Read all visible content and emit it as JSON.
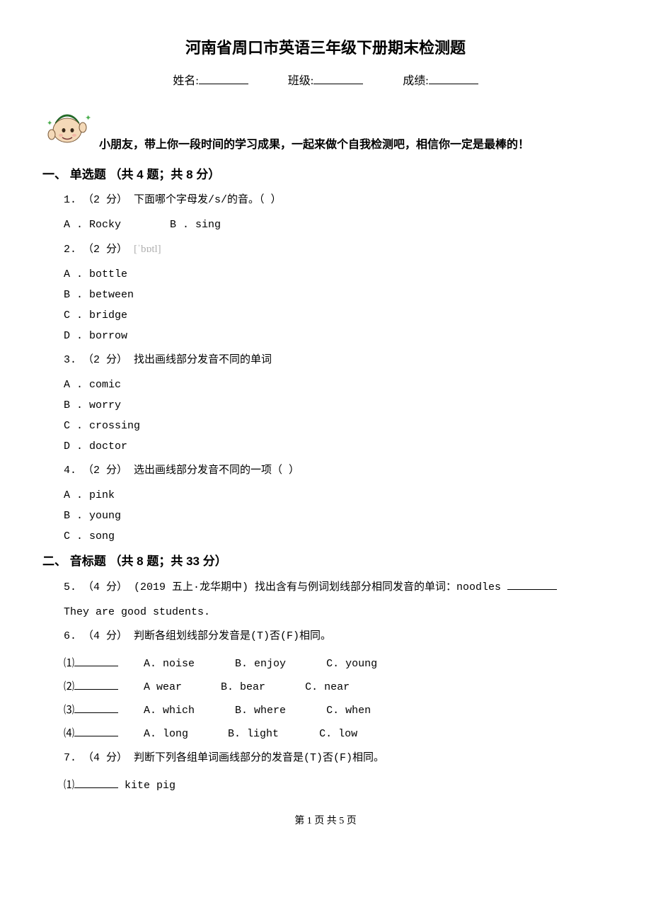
{
  "title": "河南省周口市英语三年级下册期末检测题",
  "info": {
    "name_label": "姓名:",
    "class_label": "班级:",
    "score_label": "成绩:"
  },
  "intro": "小朋友，带上你一段时间的学习成果，一起来做个自我检测吧，相信你一定是最棒的！",
  "section1": {
    "heading": "一、 单选题 （共 4 题；共 8 分）",
    "q1": {
      "stem": "1.  （2 分） 下面哪个字母发/s/的音。（     ）",
      "A": "A .  Rocky",
      "B": "B .  sing"
    },
    "q2": {
      "stem_prefix": "2.  （2 分） ",
      "phon": "[ˈbɒtl]",
      "A": "A .  bottle",
      "B": "B .  between",
      "C": "C .  bridge",
      "D": "D .  borrow"
    },
    "q3": {
      "stem": "3.  （2 分） 找出画线部分发音不同的单词",
      "A": "A .  comic",
      "B": "B .  worry",
      "C": "C .  crossing",
      "D": "D .  doctor"
    },
    "q4": {
      "stem": "4.  （2 分） 选出画线部分发音不同的一项（     ）",
      "A": "A .  pink",
      "B": "B .  young",
      "C": "C .  song"
    }
  },
  "section2": {
    "heading": "二、 音标题 （共 8 题；共 33 分）",
    "q5": {
      "stem": "5.  （4 分） (2019 五上·龙华期中)  找出含有与例词划线部分相同发音的单词：noodles ",
      "sentence": "They are good students."
    },
    "q6": {
      "stem": "6.  （4 分） 判断各组划线部分发音是(T)否(F)相同。",
      "r1": {
        "n": "⑴",
        "A": "A. noise",
        "B": "B. enjoy",
        "C": "C. young"
      },
      "r2": {
        "n": "⑵",
        "A": "A wear",
        "B": "B. bear",
        "C": "C. near"
      },
      "r3": {
        "n": "⑶",
        "A": "A. which",
        "B": "B. where",
        "C": "C. when"
      },
      "r4": {
        "n": "⑷",
        "A": "A. long",
        "B": "B. light",
        "C": "C. low"
      }
    },
    "q7": {
      "stem": "7.  （4 分） 判断下列各组单词画线部分的发音是(T)否(F)相同。",
      "r1": {
        "n": "⑴",
        "words": "kite pig"
      }
    }
  },
  "footer": "第 1 页 共 5 页"
}
